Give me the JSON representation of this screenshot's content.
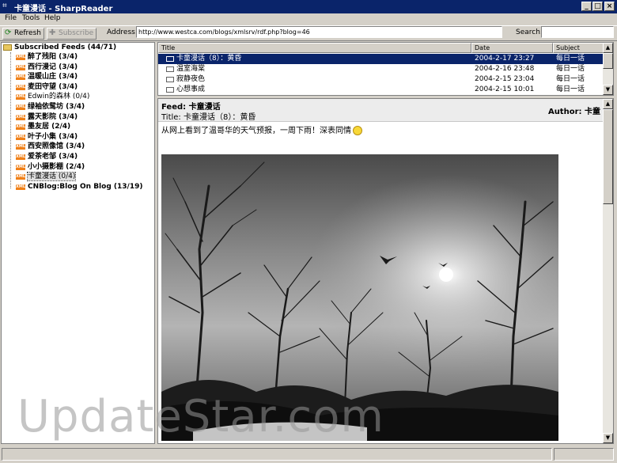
{
  "window": {
    "title": "卡童漫话 - SharpReader",
    "app_icon": "sharpreader-icon",
    "minimize": "_",
    "maximize": "□",
    "close": "×"
  },
  "menu": [
    "File",
    "Tools",
    "Help"
  ],
  "toolbar": {
    "refresh_label": "Refresh",
    "subscribe_label": "Subscribe",
    "address_label": "Address:",
    "address_value": "http://www.westca.com/blogs/xmlsrv/rdf.php?blog=46",
    "search_label": "Search:",
    "search_value": ""
  },
  "tree": {
    "root_label": "Subscribed Feeds (44/71)",
    "feeds": [
      {
        "label": "醉了残阳 (3/4)",
        "bold": true
      },
      {
        "label": "西行漫记 (3/4)",
        "bold": true
      },
      {
        "label": "温暖山庄 (3/4)",
        "bold": true
      },
      {
        "label": "麦田守望 (3/4)",
        "bold": true
      },
      {
        "label": "Edwin的森林 (0/4)",
        "bold": false
      },
      {
        "label": "绿袖依鸳坊 (3/4)",
        "bold": true
      },
      {
        "label": "露天影院 (3/4)",
        "bold": true
      },
      {
        "label": "墨友居 (2/4)",
        "bold": true
      },
      {
        "label": "叶子小集 (3/4)",
        "bold": true
      },
      {
        "label": "西安照像馆 (3/4)",
        "bold": true
      },
      {
        "label": "爱茶老邹 (3/4)",
        "bold": true
      },
      {
        "label": "小小摄影棚 (2/4)",
        "bold": true
      },
      {
        "label": "卡童漫话 (0/4)",
        "bold": false,
        "selected": true
      },
      {
        "label": "CNBlog:Blog On Blog (13/19)",
        "bold": true
      }
    ]
  },
  "list": {
    "columns": [
      "Title",
      "Date",
      "Subject"
    ],
    "rows": [
      {
        "title": "卡童漫话（8）：黄昏",
        "date": "2004-2-17 23:27",
        "subject": "每日一话",
        "selected": true
      },
      {
        "title": "温室海棠",
        "date": "2004-2-16 23:48",
        "subject": "每日一话"
      },
      {
        "title": "寂静夜色",
        "date": "2004-2-15 23:04",
        "subject": "每日一话"
      },
      {
        "title": "心想事成",
        "date": "2004-2-15 10:01",
        "subject": "每日一话"
      }
    ]
  },
  "preview": {
    "feed_line": "Feed: 卡童漫话",
    "title_line": "Title: 卡童漫话（8）：黄昏",
    "author_line": "Author: 卡童",
    "body_text": "从网上看到了温哥华的天气预报，一周下雨！深表同情",
    "image_desc": "dusk-photo"
  },
  "watermark": "UpdateStar.com",
  "colors": {
    "title_bar": "#0a246a",
    "selection": "#0a246a",
    "face": "#d4d0c8"
  }
}
